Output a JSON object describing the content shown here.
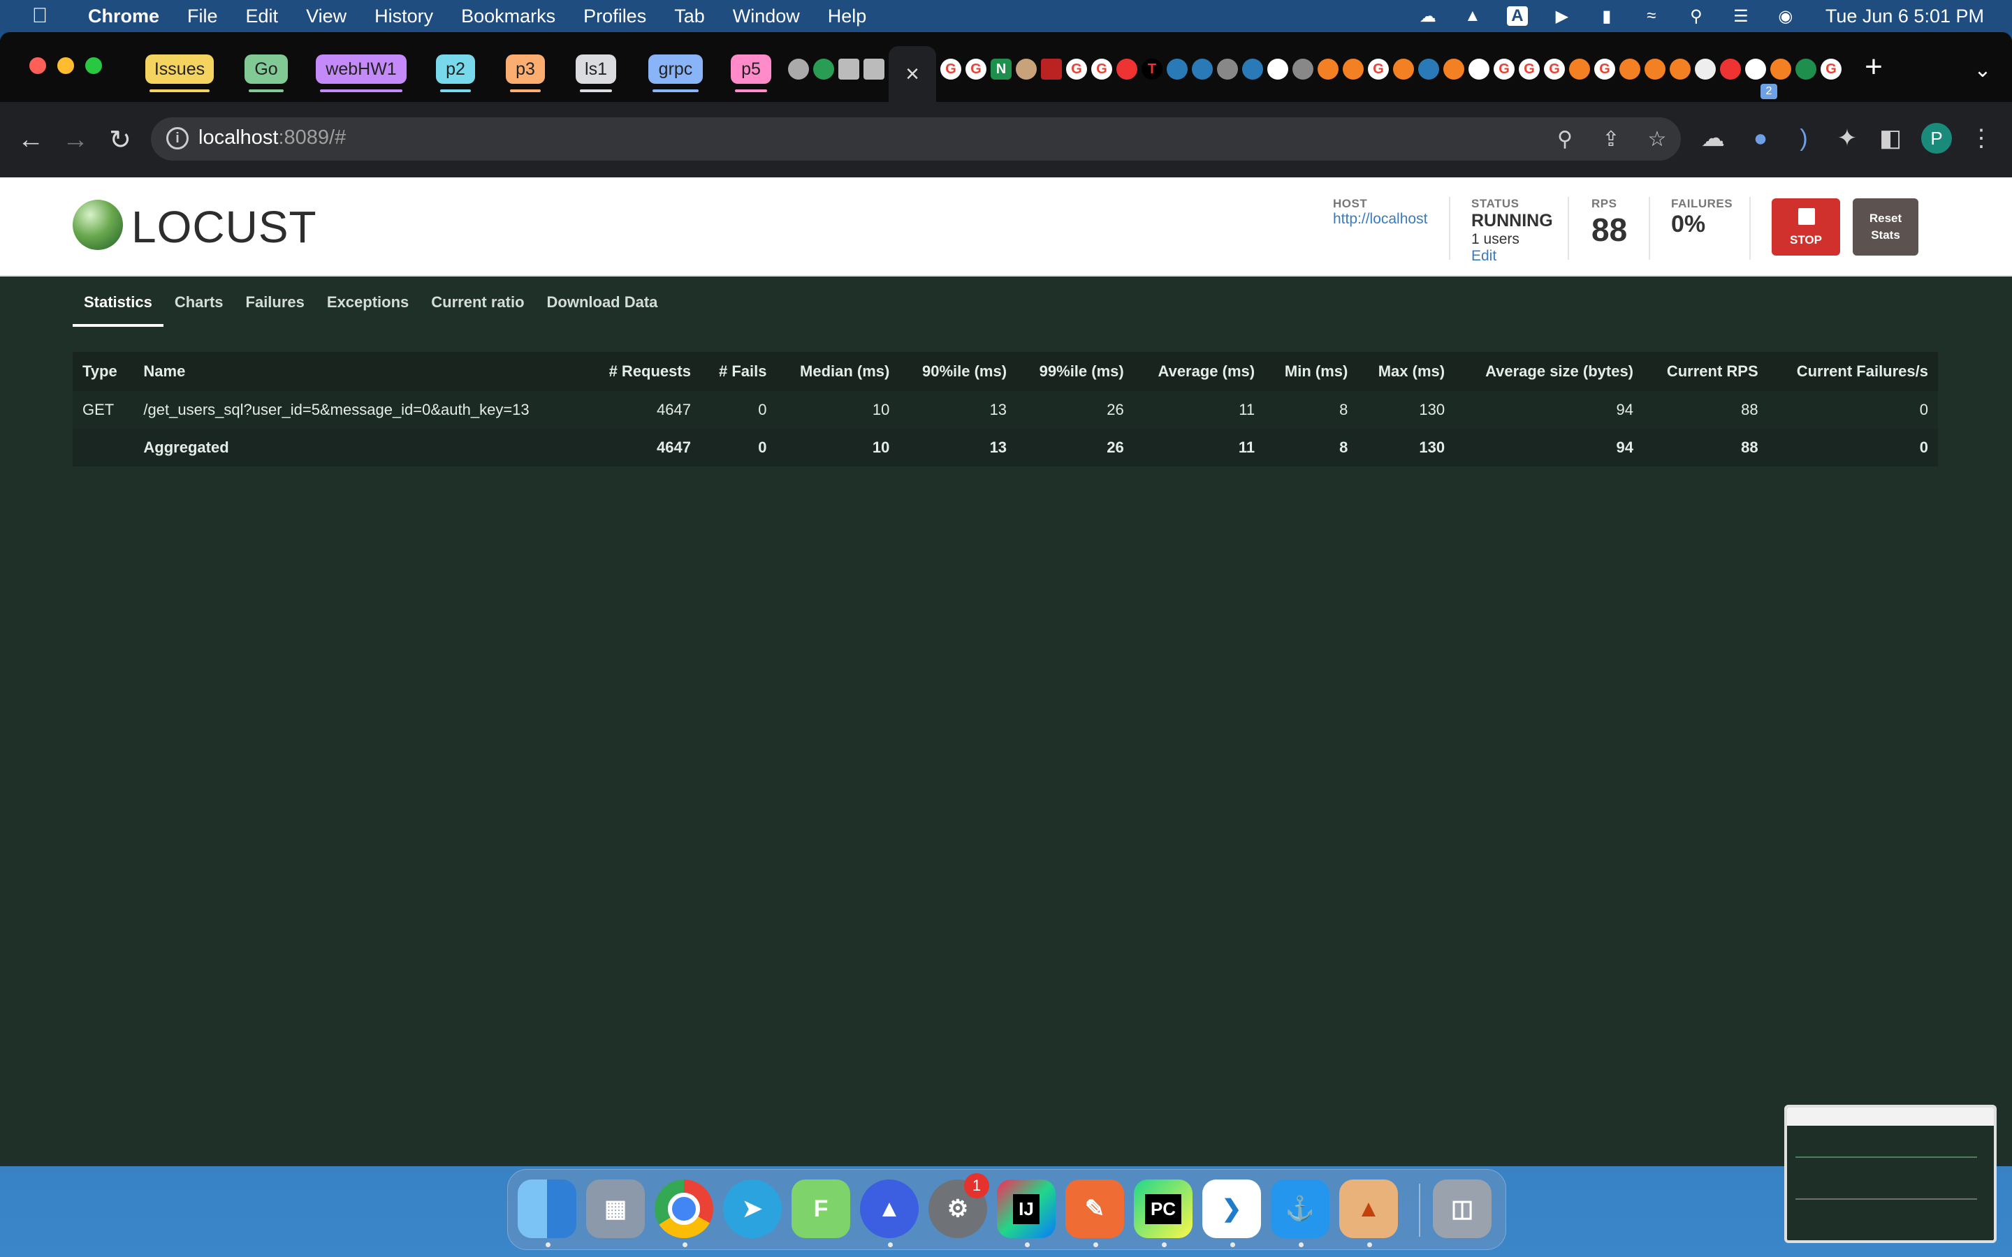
{
  "menubar": {
    "app_name": "Chrome",
    "menus": [
      "File",
      "Edit",
      "View",
      "History",
      "Bookmarks",
      "Profiles",
      "Tab",
      "Window",
      "Help"
    ],
    "clock": "Tue Jun 6  5:01 PM",
    "input_indicator": "A"
  },
  "tab_groups": [
    {
      "label": "Issues",
      "color": "#f4d35e"
    },
    {
      "label": "Go",
      "color": "#81c995"
    },
    {
      "label": "webHW1",
      "color": "#c58af9"
    },
    {
      "label": "p2",
      "color": "#78d9ec"
    },
    {
      "label": "p3",
      "color": "#fcad70"
    },
    {
      "label": "ls1",
      "color": "#dadce0"
    },
    {
      "label": "grpc",
      "color": "#8ab4f8"
    },
    {
      "label": "p5",
      "color": "#ff8bcb"
    }
  ],
  "active_tab_close": "×",
  "new_tab": "+",
  "tab_search": "⌄",
  "address_bar": {
    "host": "localhost",
    "rest": ":8089/#"
  },
  "extension_badge": "2",
  "profile_initial": "P",
  "locust": {
    "logo_text": "LOCUST",
    "host_label": "HOST",
    "host_value": "http://localhost",
    "status_label": "STATUS",
    "status_value": "RUNNING",
    "users_text": "1 users",
    "edit_link": "Edit",
    "rps_label": "RPS",
    "rps_value": "88",
    "failures_label": "FAILURES",
    "failures_value": "0%",
    "stop_label": "STOP",
    "reset_label": "Reset Stats",
    "tabs": [
      "Statistics",
      "Charts",
      "Failures",
      "Exceptions",
      "Current ratio",
      "Download Data"
    ],
    "table": {
      "headers": [
        "Type",
        "Name",
        "# Requests",
        "# Fails",
        "Median (ms)",
        "90%ile (ms)",
        "99%ile (ms)",
        "Average (ms)",
        "Min (ms)",
        "Max (ms)",
        "Average size (bytes)",
        "Current RPS",
        "Current Failures/s"
      ],
      "rows": [
        [
          "GET",
          "/get_users_sql?user_id=5&message_id=0&auth_key=13",
          "4647",
          "0",
          "10",
          "13",
          "26",
          "11",
          "8",
          "130",
          "94",
          "88",
          "0"
        ]
      ],
      "aggregated": [
        "",
        "Aggregated",
        "4647",
        "0",
        "10",
        "13",
        "26",
        "11",
        "8",
        "130",
        "94",
        "88",
        "0"
      ]
    }
  },
  "dock": {
    "notification_count": "1",
    "apps": [
      "Finder",
      "Launchpad",
      "Chrome",
      "Telegram",
      "Fleet",
      "NordVPN",
      "System Settings",
      "IntelliJ IDEA",
      "Postman",
      "PyCharm",
      "VS Code",
      "Docker",
      "Sublime Text",
      "Trash"
    ]
  }
}
